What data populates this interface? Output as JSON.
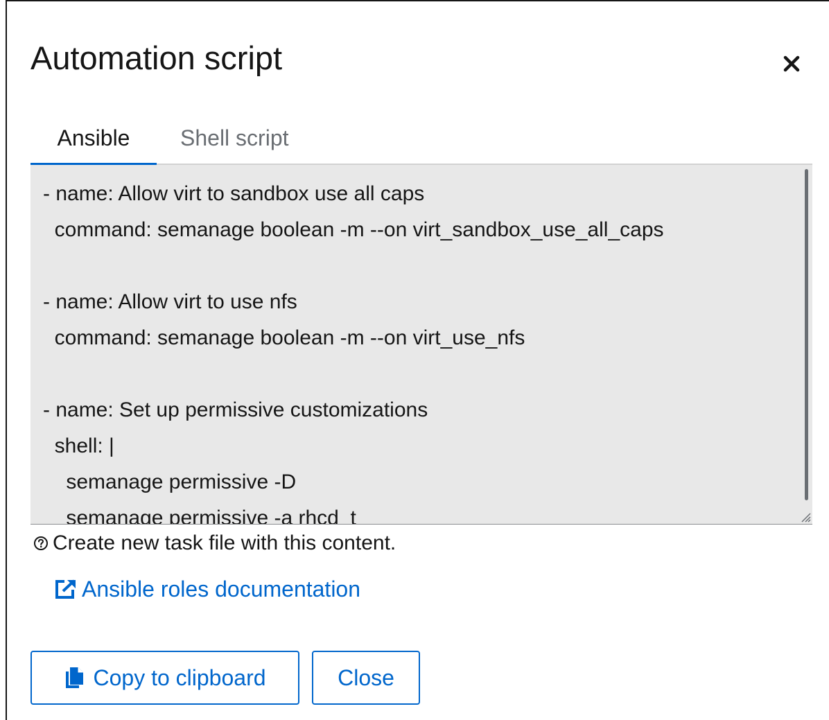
{
  "dialog": {
    "title": "Automation script",
    "close_icon": "close-icon"
  },
  "tabs": [
    {
      "label": "Ansible",
      "active": true
    },
    {
      "label": "Shell script",
      "active": false
    }
  ],
  "code": {
    "lines": [
      "- name: Allow virt to sandbox use all caps",
      "  command: semanage boolean -m --on virt_sandbox_use_all_caps",
      "",
      "- name: Allow virt to use nfs",
      "  command: semanage boolean -m --on virt_use_nfs",
      "",
      "- name: Set up permissive customizations",
      "  shell: |",
      "    semanage permissive -D",
      "    semanage permissive -a rhcd_t"
    ]
  },
  "helper": {
    "icon": "help-circle-icon",
    "text": "Create new task file with this content."
  },
  "doc_link": {
    "icon": "external-link-icon",
    "label": "Ansible roles documentation"
  },
  "footer": {
    "copy_icon": "copy-icon",
    "copy_label": "Copy to clipboard",
    "close_label": "Close"
  },
  "colors": {
    "accent": "#0066cc",
    "code_background": "#e8e8e8",
    "inactive_tab": "#6a6e73"
  }
}
